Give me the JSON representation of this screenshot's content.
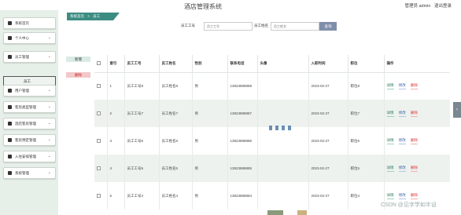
{
  "header": {
    "title": "酒店管理系统",
    "user": "管理员 admin",
    "logout": "退出登录"
  },
  "breadcrumb": {
    "home": "系统首页",
    "separator": ">",
    "current": "员工"
  },
  "sidebar": {
    "items": [
      {
        "label": "系统首页"
      },
      {
        "label": "个人中心"
      },
      {
        "label": "员工管理"
      },
      {
        "label": "用户管理"
      },
      {
        "label": "客房类型管理"
      },
      {
        "label": "酒店客房管理"
      },
      {
        "label": "客房预定管理"
      },
      {
        "label": "入住安排管理"
      },
      {
        "label": "系统管理"
      }
    ],
    "subitem": "员工"
  },
  "search": {
    "label1": "员工工号",
    "placeholder1": "员工工号",
    "label2": "员工姓名",
    "placeholder2": "员工姓名",
    "button": "查询"
  },
  "actions": {
    "add": "新增",
    "delete": "删除"
  },
  "table": {
    "headers": [
      "索引",
      "员工工号",
      "员工姓名",
      "性别",
      "联系电话",
      "头像",
      "入职时间",
      "职位",
      "操作"
    ],
    "rows": [
      {
        "index": "1",
        "id": "员工工号8",
        "name": "员工姓名8",
        "gender": "男",
        "phone": "13823888888",
        "date": "2023-02-27",
        "position": "职位8"
      },
      {
        "index": "2",
        "id": "员工工号7",
        "name": "员工姓名7",
        "gender": "男",
        "phone": "13823888887",
        "date": "2023-02-27",
        "position": "职位7"
      },
      {
        "index": "3",
        "id": "员工工号6",
        "name": "员工姓名6",
        "gender": "男",
        "phone": "13823888886",
        "date": "2023-02-27",
        "position": "职位6"
      },
      {
        "index": "4",
        "id": "员工工号5",
        "name": "员工姓名5",
        "gender": "男",
        "phone": "13823888885",
        "date": "2023-02-27",
        "position": "职位5"
      },
      {
        "index": "5",
        "id": "员工工号4",
        "name": "员工姓名4",
        "gender": "男",
        "phone": "13823888884",
        "date": "2023-02-27",
        "position": "职位4"
      }
    ],
    "ops": {
      "detail": "详情",
      "edit": "修改",
      "delete": "删除"
    }
  },
  "watermark": "CSDN @见字学如半设",
  "scroll_glyph": "‹"
}
